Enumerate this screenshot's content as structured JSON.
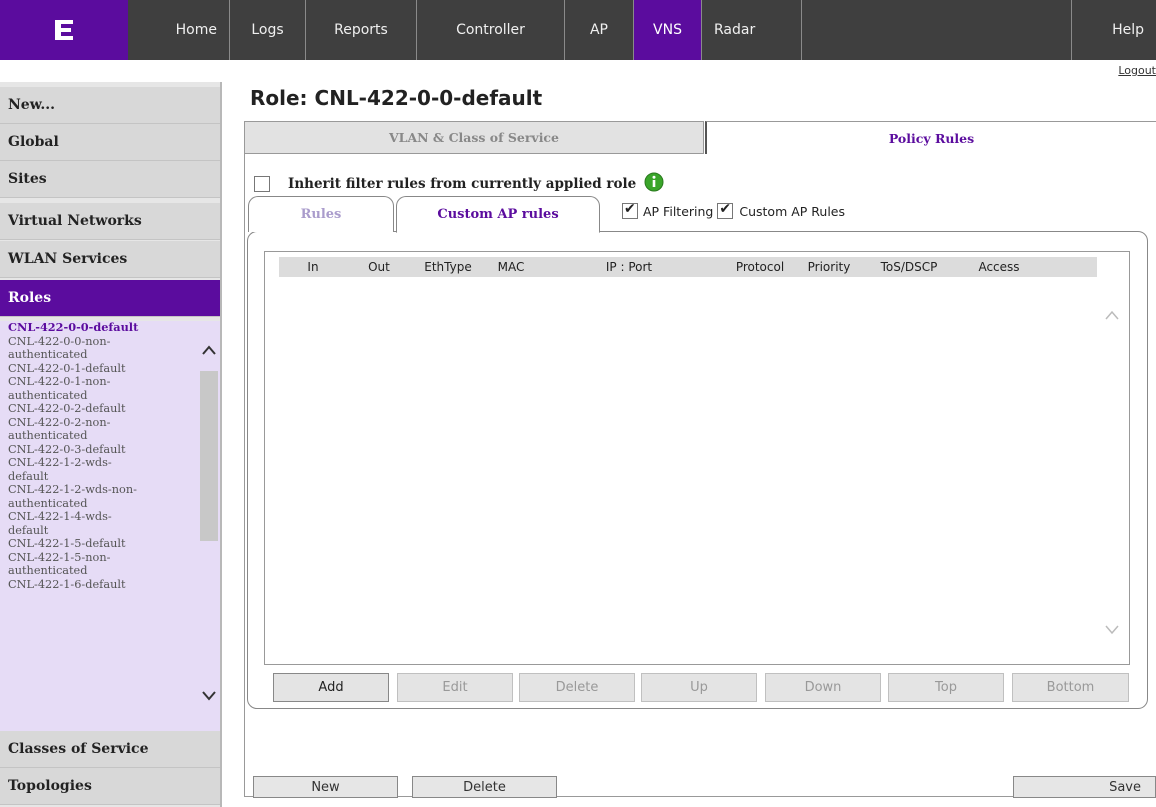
{
  "topnav": {
    "items": [
      {
        "label": "Home"
      },
      {
        "label": "Logs"
      },
      {
        "label": "Reports"
      },
      {
        "label": "Controller"
      },
      {
        "label": "AP"
      },
      {
        "label": "VNS"
      },
      {
        "label": "Radar"
      },
      {
        "label": "Help"
      }
    ],
    "active": "VNS",
    "logout": "Logout"
  },
  "sidebar": {
    "sections": [
      {
        "label": "New..."
      },
      {
        "label": "Global"
      },
      {
        "label": "Sites"
      },
      {
        "label": "Virtual Networks"
      },
      {
        "label": "WLAN Services"
      },
      {
        "label": "Roles"
      },
      {
        "label": "Classes of Service"
      },
      {
        "label": "Topologies"
      }
    ],
    "roles": [
      "CNL-422-0-0-default",
      "CNL-422-0-0-non-",
      "authenticated",
      "CNL-422-0-1-default",
      "CNL-422-0-1-non-",
      "authenticated",
      "CNL-422-0-2-default",
      "CNL-422-0-2-non-",
      "authenticated",
      "CNL-422-0-3-default",
      "CNL-422-1-2-wds-",
      "default",
      "CNL-422-1-2-wds-non-",
      "authenticated",
      "CNL-422-1-4-wds-",
      "default",
      "CNL-422-1-5-default",
      "CNL-422-1-5-non-",
      "authenticated",
      "CNL-422-1-6-default"
    ]
  },
  "main": {
    "title": "Role: CNL-422-0-0-default",
    "tabs": [
      {
        "label": "VLAN & Class of Service"
      },
      {
        "label": "Policy Rules"
      }
    ],
    "inherit_label": "Inherit filter rules from currently applied role",
    "subtabs": [
      {
        "label": "Rules"
      },
      {
        "label": "Custom AP rules"
      }
    ],
    "ap_filtering_label": "AP Filtering",
    "custom_ap_rules_label": "Custom AP Rules",
    "table_headers": [
      "In",
      "Out",
      "EthType",
      "MAC",
      "IP : Port",
      "Protocol",
      "Priority",
      "ToS/DSCP",
      "Access"
    ],
    "rule_buttons": [
      "Add",
      "Edit",
      "Delete",
      "Up",
      "Down",
      "Top",
      "Bottom"
    ],
    "bottom_buttons": {
      "new": "New",
      "delete": "Delete",
      "save": "Save"
    }
  },
  "colors": {
    "accent": "#5b0c9e",
    "nav": "#3f3f3f",
    "info": "#3aa52a"
  }
}
